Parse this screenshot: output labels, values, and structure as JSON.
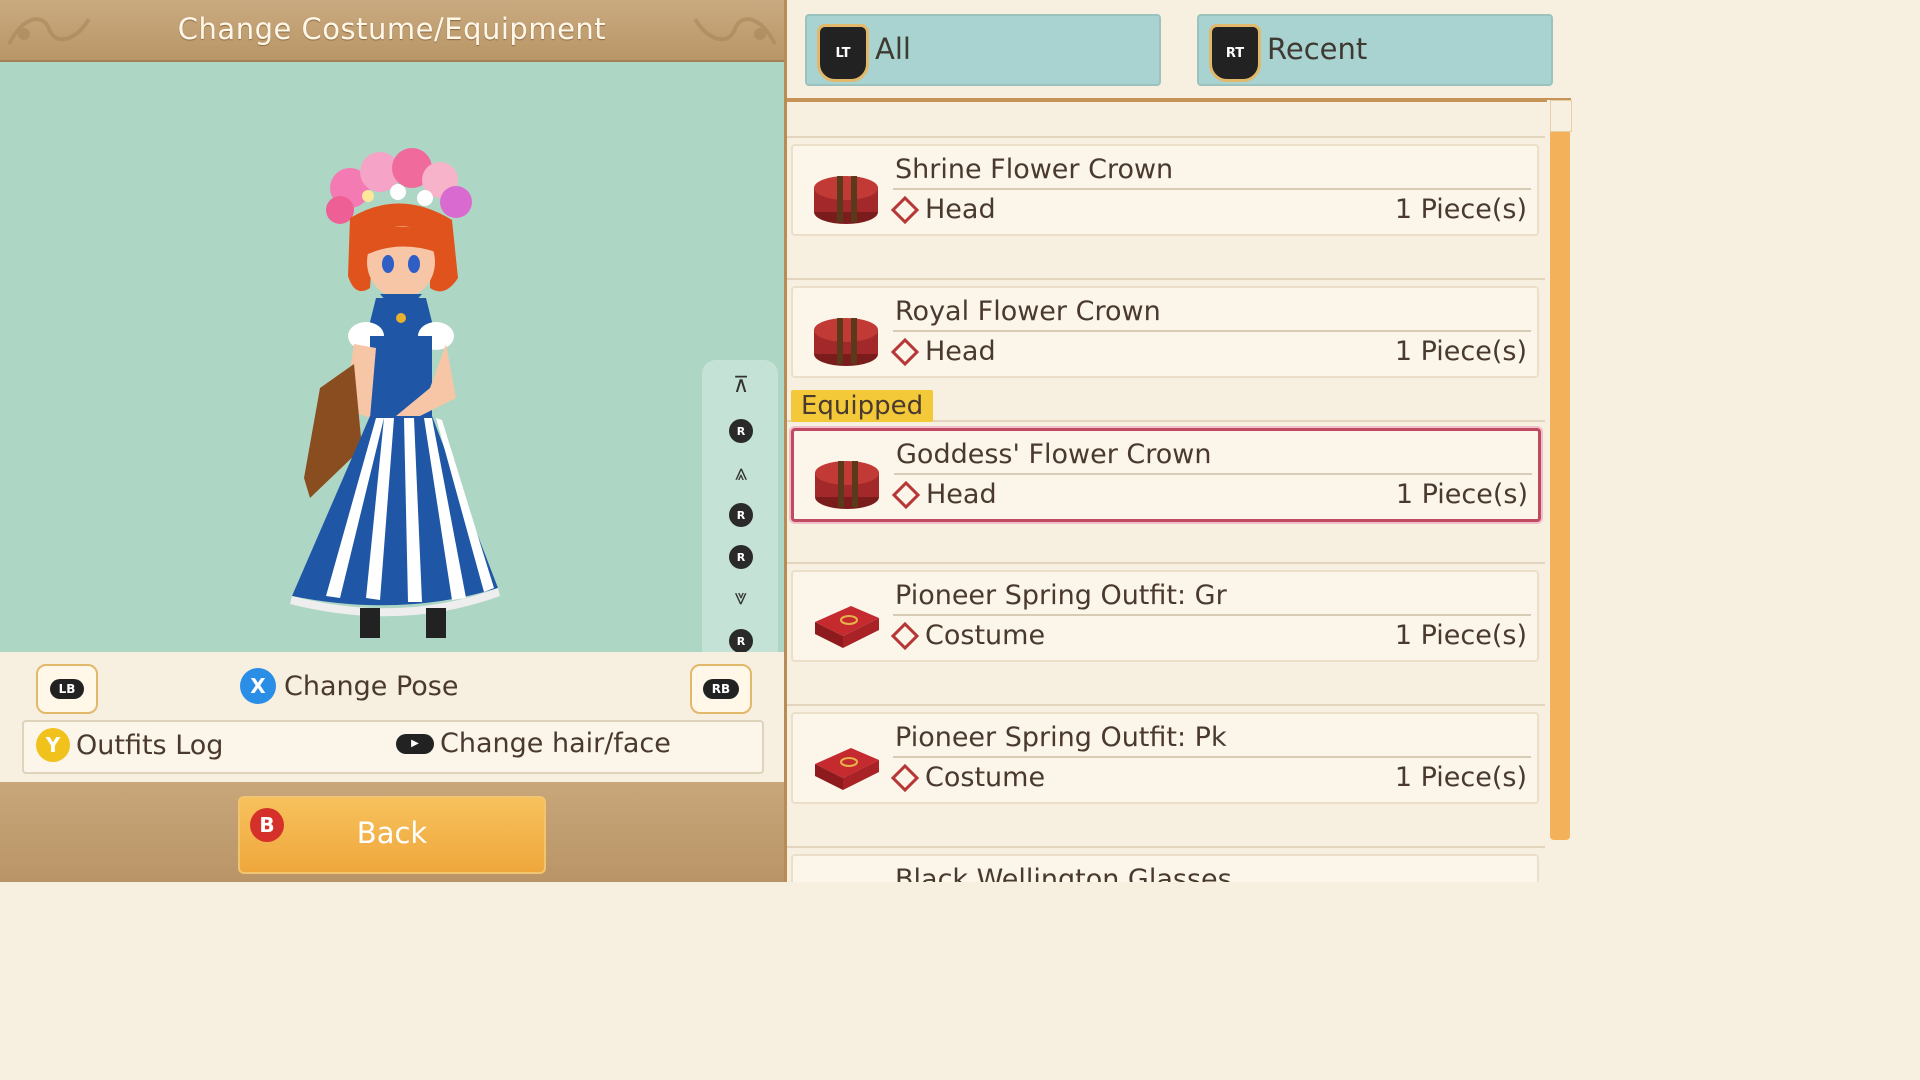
{
  "header": {
    "title": "Change Costume/Equipment"
  },
  "controls": {
    "lb": "LB",
    "rb": "RB",
    "x_button": "X",
    "change_pose": "Change Pose",
    "y_button": "Y",
    "outfits_log": "Outfits Log",
    "change_hair_face": "Change hair/face",
    "b_button": "B",
    "back": "Back",
    "rstick": "R"
  },
  "tabs": [
    {
      "trigger": "LT",
      "label": "All"
    },
    {
      "trigger": "RT",
      "label": "Recent"
    }
  ],
  "equipped_label": "Equipped",
  "items": [
    {
      "name": "Shrine Flower Crown",
      "category": "Head",
      "qty": "1 Piece(s)",
      "icon": "hatbox-icon"
    },
    {
      "name": "Royal Flower Crown",
      "category": "Head",
      "qty": "1 Piece(s)",
      "icon": "hatbox-icon"
    },
    {
      "name": "Goddess' Flower Crown",
      "category": "Head",
      "qty": "1 Piece(s)",
      "icon": "hatbox-icon",
      "equipped": true
    },
    {
      "name": "Pioneer Spring Outfit: Gr",
      "category": "Costume",
      "qty": "1 Piece(s)",
      "icon": "clothes-box-icon"
    },
    {
      "name": "Pioneer Spring Outfit: Pk",
      "category": "Costume",
      "qty": "1 Piece(s)",
      "icon": "clothes-box-icon"
    },
    {
      "name": "Black Wellington Glasses",
      "category": "",
      "qty": "",
      "icon": ""
    }
  ],
  "colors": {
    "viewer_bg": "#aed6c5",
    "tab_bg": "#a9d3d0",
    "accent_orange": "#f3b25a",
    "equipped_border": "#c04a61",
    "equipped_tag": "#f3c93a",
    "category_diamond": "#b73636"
  }
}
